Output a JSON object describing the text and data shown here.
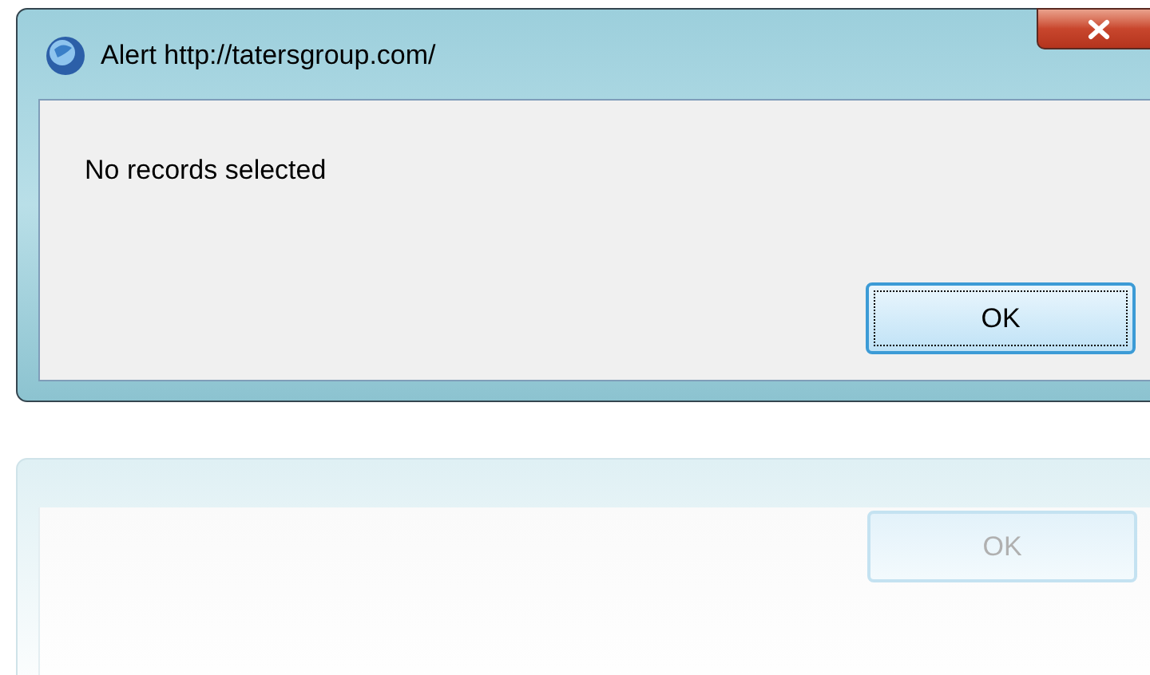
{
  "window": {
    "title": "Alert http://tatersgroup.com/"
  },
  "message": "No records selected",
  "buttons": [
    {
      "label": "OK",
      "focused": true
    }
  ],
  "reflection": {
    "buttons": [
      {
        "label": "OK"
      }
    ]
  }
}
